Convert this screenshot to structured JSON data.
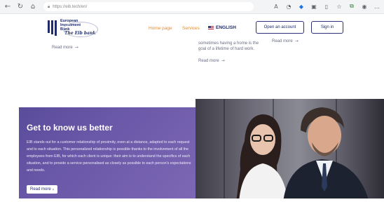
{
  "browser": {
    "url": "https://eib.tech/en/",
    "nav_icons": [
      "back-arrow-icon",
      "reload-icon",
      "home-icon"
    ],
    "ext_icons": [
      "text-size-icon",
      "translate-icon",
      "shield-icon",
      "extension-icon",
      "split-screen-icon",
      "favorites-icon",
      "collections-icon",
      "profile-icon",
      "more-icon"
    ]
  },
  "header": {
    "logo_line1": "European",
    "logo_line2": "Investment",
    "logo_line3": "Bank",
    "logo_signature": "The Eib bank",
    "nav_home": "Home page",
    "nav_services": "Services",
    "nav_lang": "ENGLISH",
    "open_account": "Open an account",
    "sign_in": "Sign in"
  },
  "cards": {
    "left_read_more": "Read more",
    "mid_line1": "sometimes having a home is the",
    "mid_line2": "goal of a lifetime of hard work.",
    "mid_read_more": "Read more",
    "right_read_more": "Read more"
  },
  "hero": {
    "title": "Get to know us better",
    "body": "EIB stands out for a customer relationship of proximity, even at a distance, adapted to each request and to each situation. This personalized relationship is possible thanks to the involvement of all the employees from EIB, for which each client is unique: their aim is to understand the specifics of each situation, and to provide a service personalised as closely as possible to each person's expectations and needs.",
    "button": "Read more"
  },
  "colors": {
    "accent_orange": "#e58b2a",
    "navy": "#1f2b6c",
    "hero_purple": "#5a4c9a"
  }
}
